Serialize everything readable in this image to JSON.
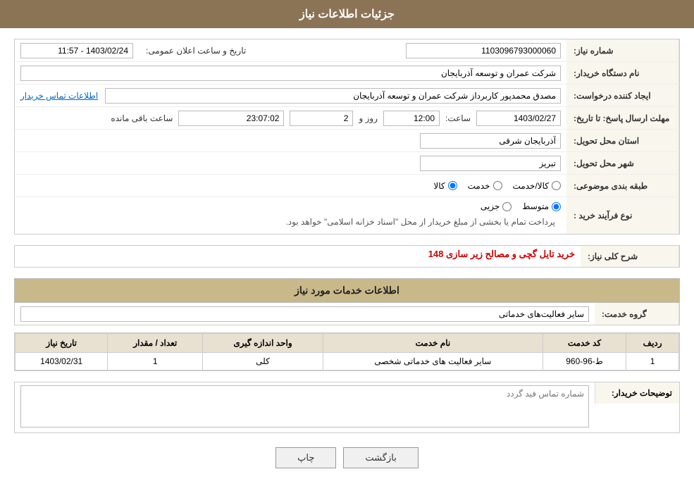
{
  "header": {
    "title": "جزئیات اطلاعات نیاز"
  },
  "fields": {
    "need_number_label": "شماره نیاز:",
    "need_number_value": "1103096793000060",
    "announce_datetime_label": "تاریخ و ساعت اعلان عمومی:",
    "announce_datetime_value": "1403/02/24 - 11:57",
    "buyer_org_label": "نام دستگاه خریدار:",
    "buyer_org_value": "شرکت عمران و توسعه آذربایجان",
    "creator_label": "ایجاد کننده درخواست:",
    "creator_value": "مصدق محمدپور کاربرداز شرکت عمران و توسعه آذربایجان",
    "contact_link": "اطلاعات تماس خریدار",
    "send_deadline_label": "مهلت ارسال پاسخ: تا تاریخ:",
    "send_deadline_date": "1403/02/27",
    "send_deadline_time_label": "ساعت:",
    "send_deadline_time": "12:00",
    "send_deadline_days_label": "روز و",
    "send_deadline_days": "2",
    "send_deadline_remaining_label": "ساعت باقی مانده",
    "send_deadline_remaining": "23:07:02",
    "province_label": "استان محل تحویل:",
    "province_value": "آذربایجان شرقی",
    "city_label": "شهر محل تحویل:",
    "city_value": "تبریز",
    "category_label": "طبقه بندی موضوعی:",
    "category_options": [
      "کالا",
      "خدمت",
      "کالا/خدمت"
    ],
    "category_selected": "کالا",
    "process_label": "نوع فرآیند خرید :",
    "process_options": [
      "جزیی",
      "متوسط"
    ],
    "process_selected": "متوسط",
    "process_notice": "پرداخت تمام یا بخشی از مبلغ خریدار از محل \"اسناد خزانه اسلامی\" خواهد بود.",
    "need_description_label": "شرح کلی نیاز:",
    "need_description_value": "خرید تایل گچی و مصالح زیر سازی 148",
    "services_section_title": "اطلاعات خدمات مورد نیاز",
    "service_group_label": "گروه خدمت:",
    "service_group_value": "سایر فعالیت‌های خدماتی",
    "table": {
      "headers": [
        "ردیف",
        "کد خدمت",
        "نام خدمت",
        "واحد اندازه گیری",
        "تعداد / مقدار",
        "تاریخ نیاز"
      ],
      "rows": [
        {
          "row": "1",
          "code": "ط-96-960",
          "name": "سایر فعالیت های خدماتی شخصی",
          "unit": "کلی",
          "quantity": "1",
          "date": "1403/02/31"
        }
      ]
    },
    "buyer_desc_label": "توضیحات خریدار:",
    "buyer_desc_placeholder": "شماره تماس فید گردد"
  },
  "buttons": {
    "print_label": "چاپ",
    "back_label": "بازگشت"
  }
}
